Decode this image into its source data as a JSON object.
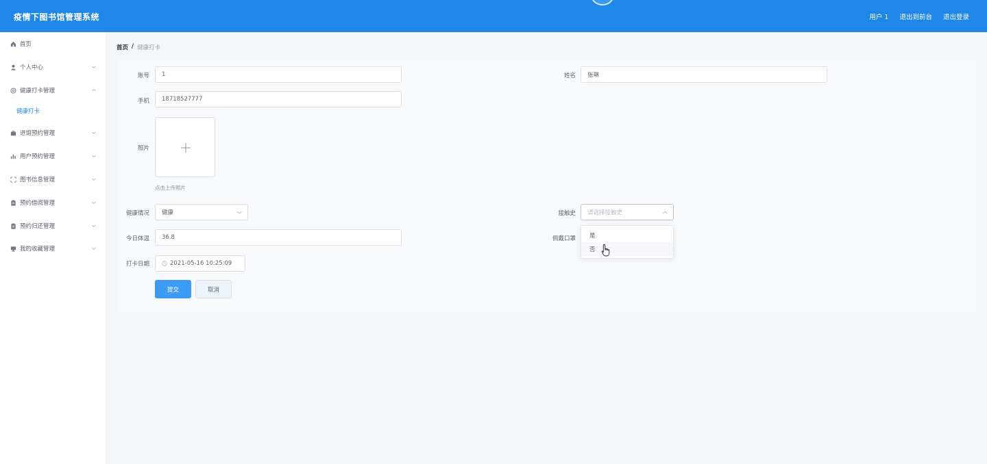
{
  "header": {
    "title": "疫情下图书馆管理系统",
    "nav": [
      "用户 1",
      "退出到前台",
      "退出登录"
    ],
    "bg_color": "#1f87e8"
  },
  "sidebar": {
    "items": [
      {
        "label": "首页",
        "icon": "home-icon"
      },
      {
        "label": "个人中心",
        "icon": "user-icon"
      },
      {
        "label": "健康打卡管理",
        "icon": "health-icon"
      },
      {
        "label": "健康打卡",
        "icon": ""
      },
      {
        "label": "进馆预约管理",
        "icon": "briefcase-icon"
      },
      {
        "label": "用户预约管理",
        "icon": "bar-chart-icon"
      },
      {
        "label": "图书信息管理",
        "icon": "expand-icon"
      },
      {
        "label": "预约借阅管理",
        "icon": "clipboard-icon"
      },
      {
        "label": "预约归还管理",
        "icon": "clipboard-icon"
      },
      {
        "label": "我的收藏管理",
        "icon": "monitor-icon"
      }
    ],
    "active_color": "#1f87e8"
  },
  "breadcrumb": {
    "home": "首页",
    "sep": "/",
    "current": "健康打卡"
  },
  "form": {
    "account": {
      "label": "账号",
      "value": "1"
    },
    "name": {
      "label": "姓名",
      "value": "张琳"
    },
    "phone": {
      "label": "手机",
      "value": "18718527777"
    },
    "photo": {
      "label": "照片",
      "tip": "点击上传照片"
    },
    "health": {
      "label": "健康情况",
      "value": "健康"
    },
    "contact": {
      "label": "接触史",
      "placeholder": "请选择接触史"
    },
    "temp": {
      "label": "今日体温",
      "value": "36.8"
    },
    "mask": {
      "label": "佩戴口罩"
    },
    "date": {
      "label": "打卡日期",
      "value": "2021-05-16 10:25:09"
    },
    "submit": "提交",
    "cancel": "取消"
  },
  "dropdown": {
    "options": [
      "是",
      "否"
    ],
    "hovered": "否"
  }
}
